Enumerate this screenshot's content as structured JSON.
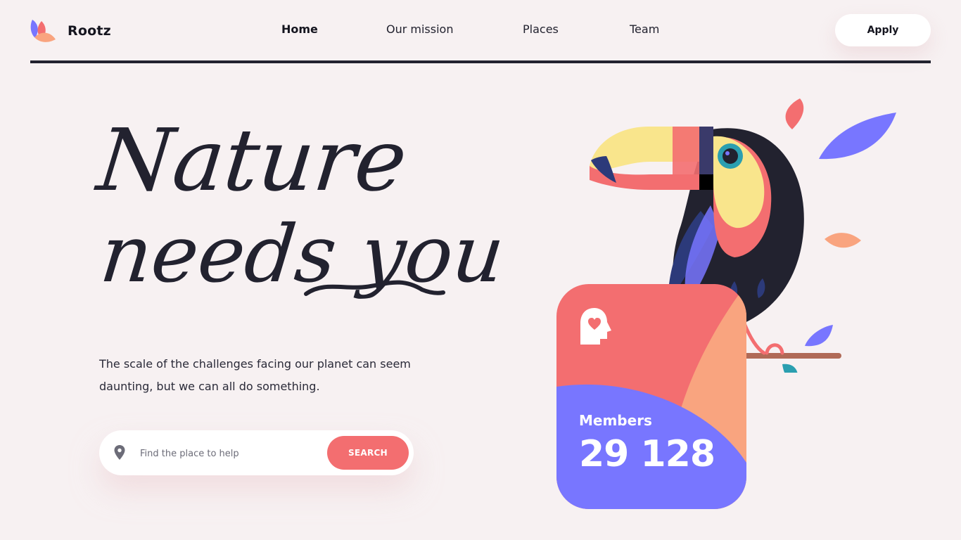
{
  "brand": {
    "name": "Rootz"
  },
  "nav": {
    "items": [
      {
        "label": "Home",
        "active": true
      },
      {
        "label": "Our mission",
        "active": false
      },
      {
        "label": "Places",
        "active": false
      },
      {
        "label": "Team",
        "active": false
      }
    ],
    "apply_label": "Apply"
  },
  "hero": {
    "headline_line1": "Nature",
    "headline_line2": "needs you",
    "description": "The scale of the challenges facing our planet can seem daunting, but we can all do something."
  },
  "search": {
    "placeholder": "Find the place to help",
    "value": "",
    "button_label": "SEARCH",
    "icon": "map-pin-icon"
  },
  "members_card": {
    "label": "Members",
    "count": "29 128",
    "icon": "head-heart-icon"
  },
  "colors": {
    "background": "#f7f1f2",
    "dark": "#22222f",
    "coral": "#f36e70",
    "peach": "#f9a47f",
    "purple": "#7876ff",
    "yellow": "#f9e58c",
    "teal": "#2b9fb0"
  }
}
